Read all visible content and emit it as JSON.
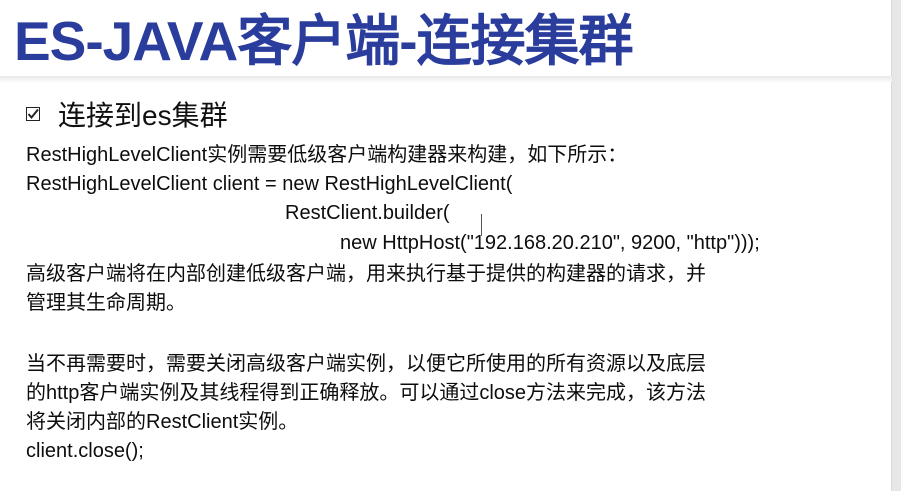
{
  "slide": {
    "title": "ES-JAVA客户端-连接集群",
    "bullet": {
      "icon": "checkbox-checked-icon",
      "text": "连接到es集群"
    },
    "lines": [
      "RestHighLevelClient实例需要低级客户端构建器来构建，如下所示：",
      "RestHighLevelClient client = new RestHighLevelClient(",
      "RestClient.builder(",
      "new HttpHost(\"192.168.20.210\", 9200, \"http\")));",
      "高级客户端将在内部创建低级客户端，用来执行基于提供的构建器的请求，并",
      "管理其生命周期。",
      "当不再需要时，需要关闭高级客户端实例，以便它所使用的所有资源以及底层",
      "的http客户端实例及其线程得到正确释放。可以通过close方法来完成，该方法",
      "将关闭内部的RestClient实例。",
      "client.close();"
    ],
    "colors": {
      "title": "#2a3d9c",
      "text": "#111111"
    }
  }
}
